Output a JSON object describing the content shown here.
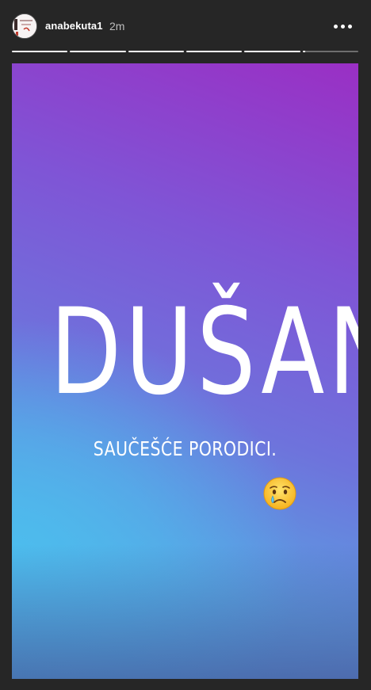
{
  "header": {
    "username": "anabekuta1",
    "time_ago": "2m",
    "more_icon": "more-options-icon"
  },
  "progress": {
    "segments_total": 6,
    "segments_complete": 5,
    "current_fraction": 0.05
  },
  "story": {
    "headline": "DUŠAN",
    "subline": "SAUČEŠĆE PORODICI.",
    "sticker": "crying-face-emoji",
    "colors": {
      "top_right": "#9a2fc4",
      "middle": "#6e73dc",
      "bottom_left": "#4ab6ea"
    }
  }
}
